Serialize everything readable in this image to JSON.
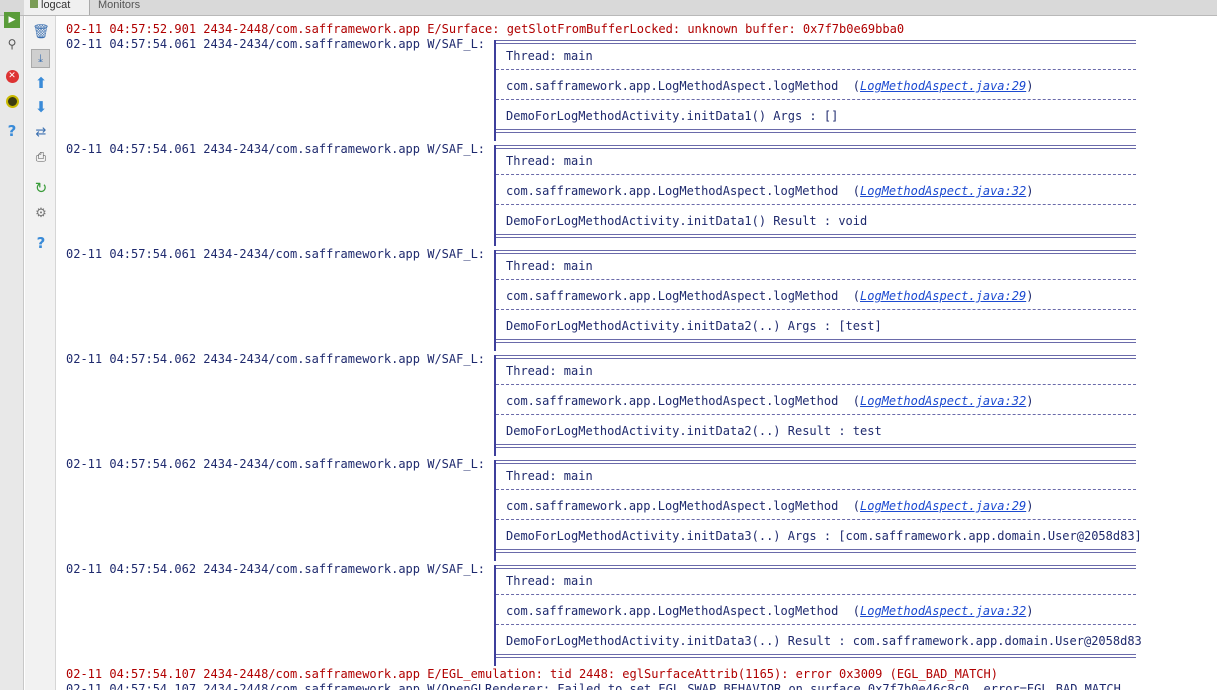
{
  "tabs": {
    "active_label": "logcat",
    "inactive_label": "Monitors"
  },
  "toolbar": {
    "icons": [
      "run-icon",
      "search-log-icon",
      "stop-icon",
      "debug-icon",
      "help-icon"
    ],
    "inner_icons": [
      "clear-log-icon",
      "scroll-to-end-icon",
      "up-arrow-icon",
      "down-arrow-icon",
      "soft-wrap-icon",
      "print-icon",
      "restart-icon",
      "settings-icon",
      "help-icon"
    ]
  },
  "log": {
    "top_error": "02-11 04:57:52.901 2434-2448/com.safframework.app E/Surface: getSlotFromBufferLocked: unknown buffer: 0x7f7b0e69bba0",
    "entries": [
      {
        "header": "02-11 04:57:54.061 2434-2434/com.safframework.app W/SAF_L:",
        "thread": "Thread: main",
        "method": "com.safframework.app.LogMethodAspect.logMethod",
        "source": "LogMethodAspect.java:29",
        "detail": "DemoForLogMethodActivity.initData1() Args : []"
      },
      {
        "header": "02-11 04:57:54.061 2434-2434/com.safframework.app W/SAF_L:",
        "thread": "Thread: main",
        "method": "com.safframework.app.LogMethodAspect.logMethod",
        "source": "LogMethodAspect.java:32",
        "detail": "DemoForLogMethodActivity.initData1() Result : void"
      },
      {
        "header": "02-11 04:57:54.061 2434-2434/com.safframework.app W/SAF_L:",
        "thread": "Thread: main",
        "method": "com.safframework.app.LogMethodAspect.logMethod",
        "source": "LogMethodAspect.java:29",
        "detail": "DemoForLogMethodActivity.initData2(..) Args : [test]"
      },
      {
        "header": "02-11 04:57:54.062 2434-2434/com.safframework.app W/SAF_L:",
        "thread": "Thread: main",
        "method": "com.safframework.app.LogMethodAspect.logMethod",
        "source": "LogMethodAspect.java:32",
        "detail": "DemoForLogMethodActivity.initData2(..) Result : test"
      },
      {
        "header": "02-11 04:57:54.062 2434-2434/com.safframework.app W/SAF_L:",
        "thread": "Thread: main",
        "method": "com.safframework.app.LogMethodAspect.logMethod",
        "source": "LogMethodAspect.java:29",
        "detail": "DemoForLogMethodActivity.initData3(..) Args : [com.safframework.app.domain.User@2058d83]"
      },
      {
        "header": "02-11 04:57:54.062 2434-2434/com.safframework.app W/SAF_L:",
        "thread": "Thread: main",
        "method": "com.safframework.app.LogMethodAspect.logMethod",
        "source": "LogMethodAspect.java:32",
        "detail": "DemoForLogMethodActivity.initData3(..) Result : com.safframework.app.domain.User@2058d83"
      }
    ],
    "bottom_error": "02-11 04:57:54.107 2434-2448/com.safframework.app E/EGL_emulation: tid 2448: eglSurfaceAttrib(1165): error 0x3009 (EGL_BAD_MATCH)",
    "bottom_warn": "02-11 04:57:54.107 2434-2448/com.safframework.app W/OpenGLRenderer: Failed to set EGL_SWAP_BEHAVIOR on surface 0x7f7b0e46c8c0, error=EGL_BAD_MATCH"
  },
  "colors": {
    "error": "#b00000",
    "warn": "#1f2a6e",
    "link": "#1c4ad1",
    "box_border": "#3e3f9c"
  }
}
